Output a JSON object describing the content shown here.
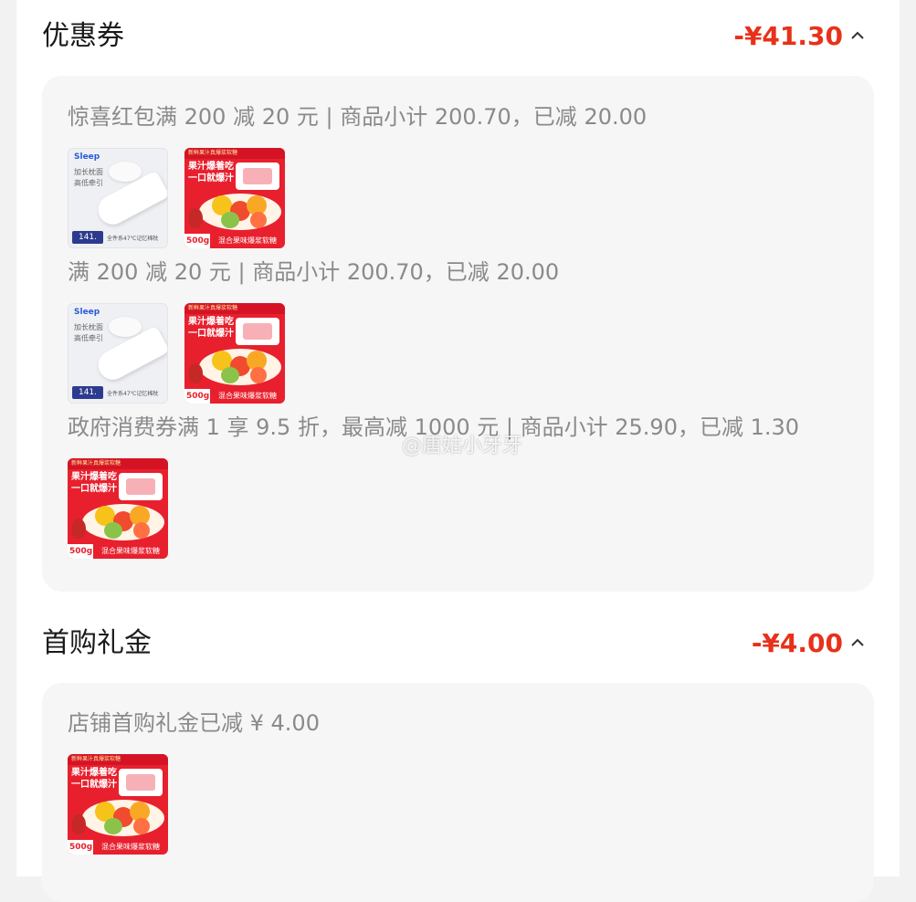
{
  "coupon_section": {
    "title": "优惠券",
    "amount": "-¥41.30",
    "groups": [
      {
        "text": "惊喜红包满 200 减 20 元 | 商品小计 200.70，已减 20.00",
        "items": [
          "pillow",
          "candy"
        ]
      },
      {
        "text": "满 200 减 20 元 | 商品小计 200.70，已减 20.00",
        "items": [
          "pillow",
          "candy"
        ]
      },
      {
        "text": "政府消费券满 1 享 9.5 折，最高减 1000 元 | 商品小计 25.90，已减 1.30",
        "items": [
          "candy"
        ]
      }
    ]
  },
  "first_purchase_section": {
    "title": "首购礼金",
    "amount": "-¥4.00",
    "groups": [
      {
        "text": "店铺首购礼金已减 ¥ 4.00",
        "items": [
          "candy"
        ]
      }
    ]
  },
  "product_pillow": {
    "brand": "Sleep",
    "tag": "加长枕面 高低牵引",
    "price": "141.",
    "footer": "全件系47℃记忆棉枕"
  },
  "product_candy": {
    "top": "新鲜果汁真爆浆软糖",
    "headline": "果汁爆着吃 一口就爆汁",
    "weight": "500g",
    "name": "混合果味爆浆软糖"
  },
  "watermark": "@唐姑小牙牙",
  "colors": {
    "accent": "#e8311a",
    "card_bg": "#f6f6f6",
    "page_bg": "#ffffff"
  }
}
